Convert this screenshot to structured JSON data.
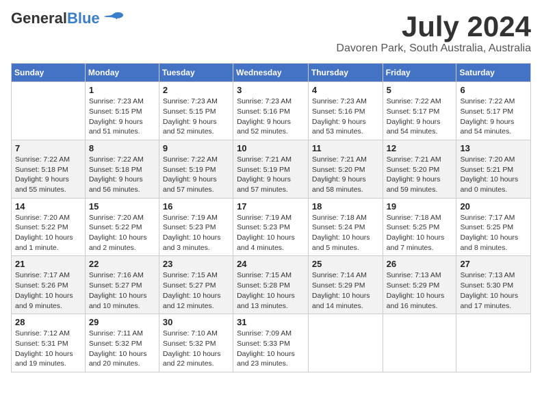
{
  "logo": {
    "general": "General",
    "blue": "Blue"
  },
  "header": {
    "month": "July 2024",
    "location": "Davoren Park, South Australia, Australia"
  },
  "weekdays": [
    "Sunday",
    "Monday",
    "Tuesday",
    "Wednesday",
    "Thursday",
    "Friday",
    "Saturday"
  ],
  "weeks": [
    [
      {
        "day": "",
        "info": ""
      },
      {
        "day": "1",
        "info": "Sunrise: 7:23 AM\nSunset: 5:15 PM\nDaylight: 9 hours\nand 51 minutes."
      },
      {
        "day": "2",
        "info": "Sunrise: 7:23 AM\nSunset: 5:15 PM\nDaylight: 9 hours\nand 52 minutes."
      },
      {
        "day": "3",
        "info": "Sunrise: 7:23 AM\nSunset: 5:16 PM\nDaylight: 9 hours\nand 52 minutes."
      },
      {
        "day": "4",
        "info": "Sunrise: 7:23 AM\nSunset: 5:16 PM\nDaylight: 9 hours\nand 53 minutes."
      },
      {
        "day": "5",
        "info": "Sunrise: 7:22 AM\nSunset: 5:17 PM\nDaylight: 9 hours\nand 54 minutes."
      },
      {
        "day": "6",
        "info": "Sunrise: 7:22 AM\nSunset: 5:17 PM\nDaylight: 9 hours\nand 54 minutes."
      }
    ],
    [
      {
        "day": "7",
        "info": "Sunrise: 7:22 AM\nSunset: 5:18 PM\nDaylight: 9 hours\nand 55 minutes."
      },
      {
        "day": "8",
        "info": "Sunrise: 7:22 AM\nSunset: 5:18 PM\nDaylight: 9 hours\nand 56 minutes."
      },
      {
        "day": "9",
        "info": "Sunrise: 7:22 AM\nSunset: 5:19 PM\nDaylight: 9 hours\nand 57 minutes."
      },
      {
        "day": "10",
        "info": "Sunrise: 7:21 AM\nSunset: 5:19 PM\nDaylight: 9 hours\nand 57 minutes."
      },
      {
        "day": "11",
        "info": "Sunrise: 7:21 AM\nSunset: 5:20 PM\nDaylight: 9 hours\nand 58 minutes."
      },
      {
        "day": "12",
        "info": "Sunrise: 7:21 AM\nSunset: 5:20 PM\nDaylight: 9 hours\nand 59 minutes."
      },
      {
        "day": "13",
        "info": "Sunrise: 7:20 AM\nSunset: 5:21 PM\nDaylight: 10 hours\nand 0 minutes."
      }
    ],
    [
      {
        "day": "14",
        "info": "Sunrise: 7:20 AM\nSunset: 5:22 PM\nDaylight: 10 hours\nand 1 minute."
      },
      {
        "day": "15",
        "info": "Sunrise: 7:20 AM\nSunset: 5:22 PM\nDaylight: 10 hours\nand 2 minutes."
      },
      {
        "day": "16",
        "info": "Sunrise: 7:19 AM\nSunset: 5:23 PM\nDaylight: 10 hours\nand 3 minutes."
      },
      {
        "day": "17",
        "info": "Sunrise: 7:19 AM\nSunset: 5:23 PM\nDaylight: 10 hours\nand 4 minutes."
      },
      {
        "day": "18",
        "info": "Sunrise: 7:18 AM\nSunset: 5:24 PM\nDaylight: 10 hours\nand 5 minutes."
      },
      {
        "day": "19",
        "info": "Sunrise: 7:18 AM\nSunset: 5:25 PM\nDaylight: 10 hours\nand 7 minutes."
      },
      {
        "day": "20",
        "info": "Sunrise: 7:17 AM\nSunset: 5:25 PM\nDaylight: 10 hours\nand 8 minutes."
      }
    ],
    [
      {
        "day": "21",
        "info": "Sunrise: 7:17 AM\nSunset: 5:26 PM\nDaylight: 10 hours\nand 9 minutes."
      },
      {
        "day": "22",
        "info": "Sunrise: 7:16 AM\nSunset: 5:27 PM\nDaylight: 10 hours\nand 10 minutes."
      },
      {
        "day": "23",
        "info": "Sunrise: 7:15 AM\nSunset: 5:27 PM\nDaylight: 10 hours\nand 12 minutes."
      },
      {
        "day": "24",
        "info": "Sunrise: 7:15 AM\nSunset: 5:28 PM\nDaylight: 10 hours\nand 13 minutes."
      },
      {
        "day": "25",
        "info": "Sunrise: 7:14 AM\nSunset: 5:29 PM\nDaylight: 10 hours\nand 14 minutes."
      },
      {
        "day": "26",
        "info": "Sunrise: 7:13 AM\nSunset: 5:29 PM\nDaylight: 10 hours\nand 16 minutes."
      },
      {
        "day": "27",
        "info": "Sunrise: 7:13 AM\nSunset: 5:30 PM\nDaylight: 10 hours\nand 17 minutes."
      }
    ],
    [
      {
        "day": "28",
        "info": "Sunrise: 7:12 AM\nSunset: 5:31 PM\nDaylight: 10 hours\nand 19 minutes."
      },
      {
        "day": "29",
        "info": "Sunrise: 7:11 AM\nSunset: 5:32 PM\nDaylight: 10 hours\nand 20 minutes."
      },
      {
        "day": "30",
        "info": "Sunrise: 7:10 AM\nSunset: 5:32 PM\nDaylight: 10 hours\nand 22 minutes."
      },
      {
        "day": "31",
        "info": "Sunrise: 7:09 AM\nSunset: 5:33 PM\nDaylight: 10 hours\nand 23 minutes."
      },
      {
        "day": "",
        "info": ""
      },
      {
        "day": "",
        "info": ""
      },
      {
        "day": "",
        "info": ""
      }
    ]
  ]
}
